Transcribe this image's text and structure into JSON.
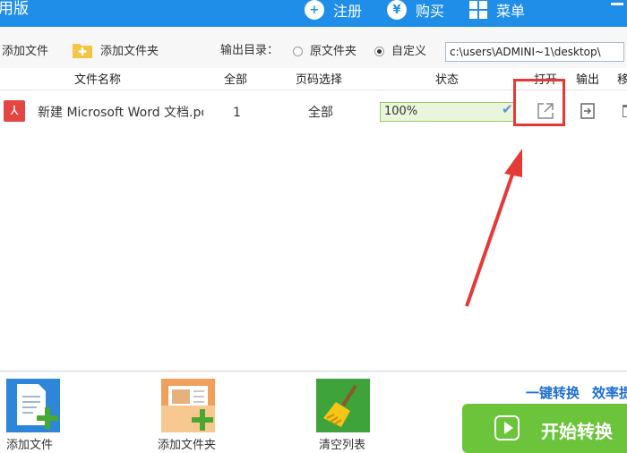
{
  "titlebar": {
    "title": "用版",
    "register": "注册",
    "buy": "购买",
    "menu": "菜单"
  },
  "toolbar": {
    "add_file": "添加文件",
    "add_folder": "添加文件夹",
    "output_dir_label": "输出目录：",
    "opt_source": "原文件夹",
    "opt_custom": "自定义",
    "selected": "自定义",
    "output_path": "c:\\users\\ADMINI~1\\desktop\\"
  },
  "table": {
    "headers": {
      "name": "文件名称",
      "total": "全部",
      "page_select": "页码选择",
      "status": "状态",
      "open": "打开",
      "export": "输出",
      "move": "移"
    },
    "rows": [
      {
        "name": "新建 Microsoft Word 文档.pdf",
        "total": "1",
        "page_select": "全部",
        "status": "100%",
        "progress": 1.0
      }
    ]
  },
  "bottom": {
    "add_file": "添加文件",
    "add_folder": "添加文件夹",
    "clear_list": "清空列表",
    "one_click": "一键转换",
    "efficiency": "效率提",
    "start": "开始转换"
  },
  "colors": {
    "titlebar": "#1f8ee9",
    "start_button": "#6cc43a",
    "highlight": "#e53935",
    "pdf_icon": "#e34543",
    "link": "#1f6fd0"
  }
}
